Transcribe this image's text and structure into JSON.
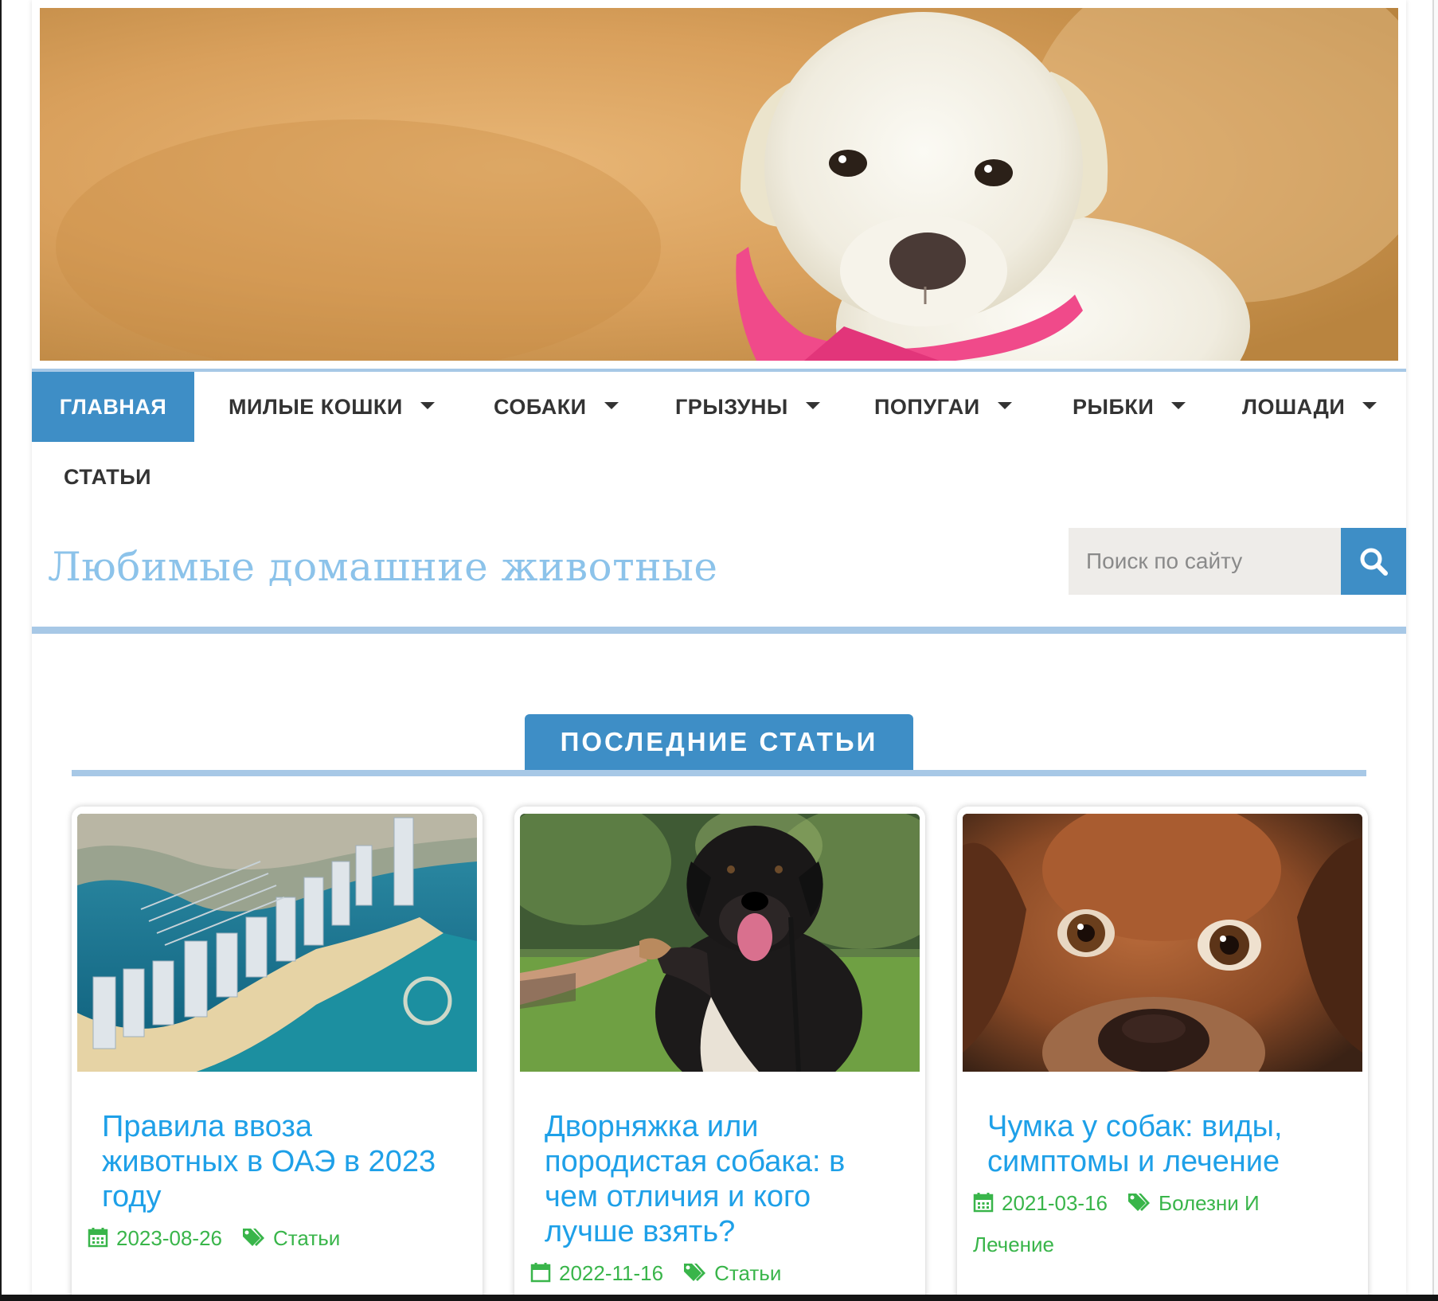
{
  "nav": {
    "items": [
      {
        "label": "ГЛАВНАЯ",
        "active": true,
        "dropdown": false
      },
      {
        "label": "МИЛЫЕ КОШКИ",
        "dropdown": true
      },
      {
        "label": "СОБАКИ",
        "dropdown": true
      },
      {
        "label": "ГРЫЗУНЫ",
        "dropdown": true
      },
      {
        "label": "ПОПУГАИ",
        "dropdown": true
      },
      {
        "label": "РЫБКИ",
        "dropdown": true
      },
      {
        "label": "ЛОШАДИ",
        "dropdown": true
      },
      {
        "label": "СТАТЬИ",
        "dropdown": false
      }
    ]
  },
  "site": {
    "title": "Любимые домашние животные"
  },
  "search": {
    "placeholder": "Поиск по сайту",
    "icon": "search-icon"
  },
  "section": {
    "title": "ПОСЛЕДНИЕ СТАТЬИ"
  },
  "articles": [
    {
      "title": "Правила ввоза животных в ОАЭ в 2023 году",
      "date": "2023-08-26",
      "category": "Статьи",
      "image": "dubai-harbour-aerial"
    },
    {
      "title": "Дворняжка или породистая собака: в чем отличия и кого лучше взять?",
      "date": "2022-11-16",
      "category": "Статьи",
      "image": "dog-giving-paw"
    },
    {
      "title": "Чумка у собак: виды, симптомы и лечение",
      "date": "2021-03-16",
      "category": "Болезни И Лечение",
      "image": "beagle-closeup"
    }
  ],
  "colors": {
    "accent": "#3e8ec6",
    "accent_light": "#a7c8e6",
    "title_blue": "#8cc3ea",
    "link_blue": "#1ea0e8",
    "meta_green": "#39b54a"
  },
  "icons": {
    "date": "calendar-icon",
    "category": "tags-icon",
    "dropdown": "caret-down-icon"
  }
}
